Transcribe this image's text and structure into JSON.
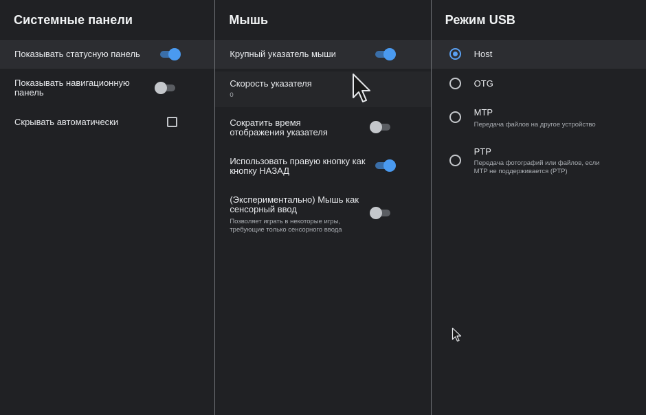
{
  "system_panels": {
    "title": "Системные панели",
    "show_status_bar": {
      "label": "Показывать статусную панель",
      "enabled": true
    },
    "show_nav_bar": {
      "label": "Показывать навигационную панель",
      "enabled": false
    },
    "auto_hide": {
      "label": "Скрывать автоматически",
      "checked": false
    }
  },
  "mouse": {
    "title": "Мышь",
    "large_pointer": {
      "label": "Крупный указатель мыши",
      "enabled": true
    },
    "pointer_speed": {
      "label": "Скорость указателя",
      "value": "0"
    },
    "reduce_display_time": {
      "label": "Сократить время отображения указателя",
      "enabled": false
    },
    "right_button_back": {
      "label": "Использовать правую кнопку как кнопку НАЗАД",
      "enabled": true
    },
    "mouse_as_touch": {
      "label": "(Экспериментально) Мышь как сенсорный ввод",
      "description": "Позволяет играть в некоторые игры, требующие только сенсорного ввода",
      "enabled": false
    }
  },
  "usb_mode": {
    "title": "Режим USB",
    "selected": "Host",
    "options": [
      {
        "label": "Host",
        "description": ""
      },
      {
        "label": "OTG",
        "description": ""
      },
      {
        "label": "MTP",
        "description": "Передача файлов на другое устройство"
      },
      {
        "label": "PTP",
        "description": "Передача фотографий или файлов, если MTP не поддерживается (PTP)"
      }
    ]
  },
  "colors": {
    "background": "#202124",
    "highlight_row": "#2c2d31",
    "accent": "#4a9af0",
    "divider": "#6f7276"
  },
  "icons": {
    "large_cursor": "mouse-pointer-large-icon",
    "small_cursor": "mouse-pointer-small-icon"
  }
}
